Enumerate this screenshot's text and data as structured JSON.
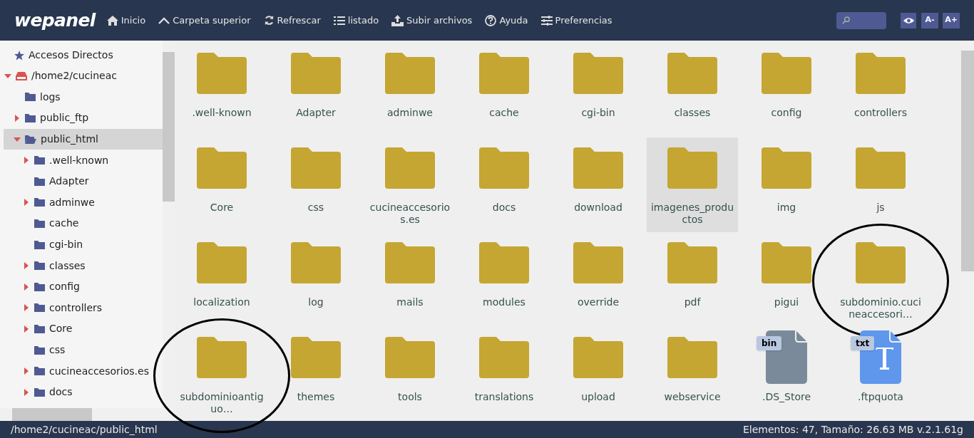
{
  "header": {
    "logo": "wepanel",
    "nav": [
      {
        "label": "Inicio"
      },
      {
        "label": "Carpeta superior"
      },
      {
        "label": "Refrescar"
      },
      {
        "label": "listado"
      },
      {
        "label": "Subir archivos"
      },
      {
        "label": "Ayuda"
      },
      {
        "label": "Preferencias"
      }
    ],
    "font_buttons": [
      "A-",
      "A+"
    ]
  },
  "sidebar": {
    "shortcuts": "Accesos Directos",
    "tree": [
      {
        "label": "/home2/cucineac",
        "kind": "drive",
        "has_children": true,
        "expanded": true,
        "selected": false,
        "children": [
          {
            "label": "logs",
            "kind": "folder",
            "has_children": false,
            "expanded": false,
            "selected": false
          },
          {
            "label": "public_ftp",
            "kind": "folder",
            "has_children": true,
            "expanded": false,
            "selected": false
          },
          {
            "label": "public_html",
            "kind": "folder",
            "has_children": true,
            "expanded": true,
            "selected": true,
            "children": [
              {
                "label": ".well-known",
                "kind": "folder",
                "has_children": true,
                "expanded": false,
                "selected": false
              },
              {
                "label": "Adapter",
                "kind": "folder",
                "has_children": false,
                "expanded": false,
                "selected": false
              },
              {
                "label": "adminwe",
                "kind": "folder",
                "has_children": true,
                "expanded": false,
                "selected": false
              },
              {
                "label": "cache",
                "kind": "folder",
                "has_children": false,
                "expanded": false,
                "selected": false
              },
              {
                "label": "cgi-bin",
                "kind": "folder",
                "has_children": false,
                "expanded": false,
                "selected": false
              },
              {
                "label": "classes",
                "kind": "folder",
                "has_children": true,
                "expanded": false,
                "selected": false
              },
              {
                "label": "config",
                "kind": "folder",
                "has_children": true,
                "expanded": false,
                "selected": false
              },
              {
                "label": "controllers",
                "kind": "folder",
                "has_children": true,
                "expanded": false,
                "selected": false
              },
              {
                "label": "Core",
                "kind": "folder",
                "has_children": true,
                "expanded": false,
                "selected": false
              },
              {
                "label": "css",
                "kind": "folder",
                "has_children": false,
                "expanded": false,
                "selected": false
              },
              {
                "label": "cucineaccesorios.es",
                "kind": "folder",
                "has_children": true,
                "expanded": false,
                "selected": false
              },
              {
                "label": "docs",
                "kind": "folder",
                "has_children": true,
                "expanded": false,
                "selected": false
              }
            ]
          }
        ]
      }
    ]
  },
  "items": [
    {
      "name": ".well-known",
      "kind": "folder",
      "selected": false,
      "circled": false
    },
    {
      "name": "Adapter",
      "kind": "folder",
      "selected": false,
      "circled": false
    },
    {
      "name": "adminwe",
      "kind": "folder",
      "selected": false,
      "circled": false
    },
    {
      "name": "cache",
      "kind": "folder",
      "selected": false,
      "circled": false
    },
    {
      "name": "cgi-bin",
      "kind": "folder",
      "selected": false,
      "circled": false
    },
    {
      "name": "classes",
      "kind": "folder",
      "selected": false,
      "circled": false
    },
    {
      "name": "config",
      "kind": "folder",
      "selected": false,
      "circled": false
    },
    {
      "name": "controllers",
      "kind": "folder",
      "selected": false,
      "circled": false
    },
    {
      "name": "Core",
      "kind": "folder",
      "selected": false,
      "circled": false
    },
    {
      "name": "css",
      "kind": "folder",
      "selected": false,
      "circled": false
    },
    {
      "name": "cucineaccesorios.es",
      "kind": "folder",
      "selected": false,
      "circled": false
    },
    {
      "name": "docs",
      "kind": "folder",
      "selected": false,
      "circled": false
    },
    {
      "name": "download",
      "kind": "folder",
      "selected": false,
      "circled": false
    },
    {
      "name": "imagenes_productos",
      "kind": "folder",
      "selected": true,
      "circled": false
    },
    {
      "name": "img",
      "kind": "folder",
      "selected": false,
      "circled": false
    },
    {
      "name": "js",
      "kind": "folder",
      "selected": false,
      "circled": false
    },
    {
      "name": "localization",
      "kind": "folder",
      "selected": false,
      "circled": false
    },
    {
      "name": "log",
      "kind": "folder",
      "selected": false,
      "circled": false
    },
    {
      "name": "mails",
      "kind": "folder",
      "selected": false,
      "circled": false
    },
    {
      "name": "modules",
      "kind": "folder",
      "selected": false,
      "circled": false
    },
    {
      "name": "override",
      "kind": "folder",
      "selected": false,
      "circled": false
    },
    {
      "name": "pdf",
      "kind": "folder",
      "selected": false,
      "circled": false
    },
    {
      "name": "pigui",
      "kind": "folder",
      "selected": false,
      "circled": false
    },
    {
      "name": "subdominio.cucineaccesori…",
      "kind": "folder",
      "selected": false,
      "circled": true
    },
    {
      "name": "subdominioantiguo…",
      "kind": "folder",
      "selected": false,
      "circled": true
    },
    {
      "name": "themes",
      "kind": "folder",
      "selected": false,
      "circled": false
    },
    {
      "name": "tools",
      "kind": "folder",
      "selected": false,
      "circled": false
    },
    {
      "name": "translations",
      "kind": "folder",
      "selected": false,
      "circled": false
    },
    {
      "name": "upload",
      "kind": "folder",
      "selected": false,
      "circled": false
    },
    {
      "name": "webservice",
      "kind": "folder",
      "selected": false,
      "circled": false
    },
    {
      "name": ".DS_Store",
      "kind": "file",
      "badge": "bin",
      "color": "#7a8a9a",
      "selected": false,
      "circled": false
    },
    {
      "name": ".ftpquota",
      "kind": "text-file",
      "badge": "txt",
      "color": "#5f97ec",
      "selected": false,
      "circled": false
    }
  ],
  "status_bar": {
    "path": "/home2/cucineac/public_html",
    "summary": "Elementos: 47, Tamaño: 26.63 MB v.2.1.61g"
  }
}
